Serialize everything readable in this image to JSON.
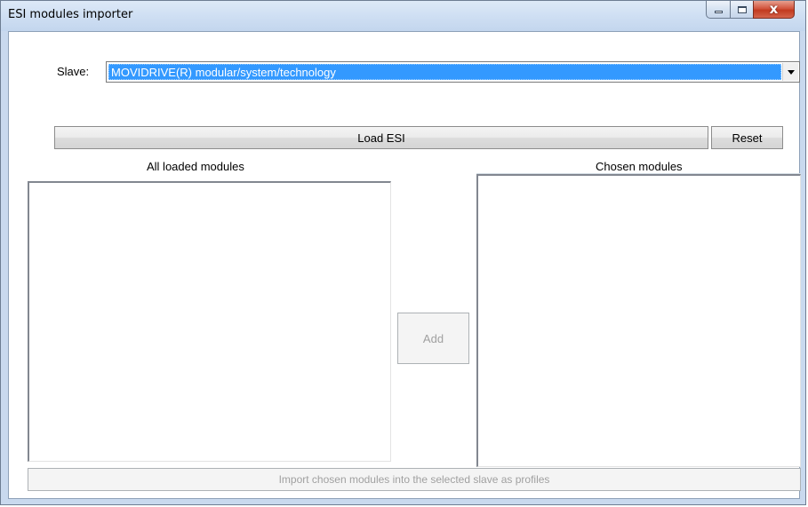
{
  "window": {
    "title": "ESI modules importer",
    "controls": {
      "minimize_icon": "minimize-icon",
      "maximize_icon": "maximize-icon",
      "close_icon": "close-icon",
      "close_glyph": "x"
    }
  },
  "slave": {
    "label": "Slave:",
    "selected_value": "MOVIDRIVE(R) modular/system/technology",
    "dropdown_icon": "chevron-down-icon"
  },
  "buttons": {
    "load_esi": "Load ESI",
    "reset": "Reset",
    "add": "Add",
    "import": "Import chosen modules into the selected slave as profiles"
  },
  "lists": {
    "all_loaded_title": "All loaded modules",
    "chosen_title": "Chosen modules"
  },
  "colors": {
    "selection": "#3399ff",
    "titlebar": "#c9d9ee",
    "close_button": "#c23a1f"
  }
}
